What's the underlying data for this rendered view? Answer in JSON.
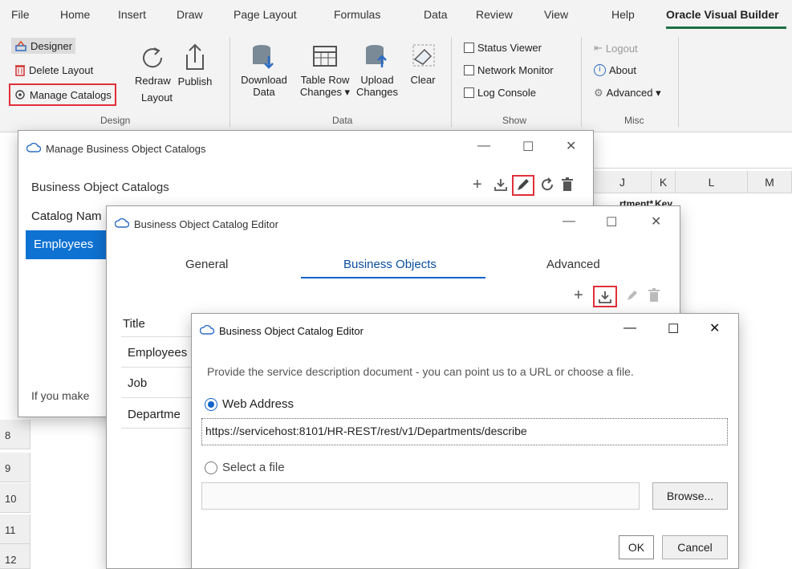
{
  "ribbon_tabs": [
    "File",
    "Home",
    "Insert",
    "Draw",
    "Page Layout",
    "Formulas",
    "Data",
    "Review",
    "View",
    "Help",
    "Oracle Visual Builder"
  ],
  "design_group": {
    "designer": "Designer",
    "delete_layout": "Delete Layout",
    "manage_catalogs": "Manage Catalogs",
    "redraw_line1": "Redraw",
    "redraw_line2": "Layout",
    "publish": "Publish",
    "label": "Design"
  },
  "data_group": {
    "download_line1": "Download",
    "download_line2": "Data",
    "tablerow_line1": "Table Row",
    "tablerow_line2": "Changes ▾",
    "upload_line1": "Upload",
    "upload_line2": "Changes",
    "clear": "Clear",
    "label": "Data"
  },
  "show_group": {
    "status_viewer": "Status Viewer",
    "network_monitor": "Network Monitor",
    "log_console": "Log Console",
    "label": "Show"
  },
  "misc_group": {
    "logout": "Logout",
    "about": "About",
    "advanced": "Advanced ▾",
    "label": "Misc"
  },
  "sheet": {
    "columns": [
      "J",
      "K",
      "L",
      "M"
    ],
    "cell_j": "…rtment*",
    "cell_k": "Key",
    "rows": [
      "8",
      "9",
      "10",
      "11",
      "12"
    ]
  },
  "manage_dialog": {
    "title": "Manage Business Object Catalogs",
    "heading": "Business Object Catalogs",
    "col_header": "Catalog Nam",
    "row": "Employees",
    "footer": "If you make"
  },
  "editor_dialog": {
    "title": "Business Object Catalog Editor",
    "tabs": [
      "General",
      "Business Objects",
      "Advanced"
    ],
    "list_header": "Title",
    "rows": [
      "Employees",
      "Job",
      "Departme"
    ]
  },
  "url_dialog": {
    "title": "Business Object Catalog Editor",
    "prompt": "Provide the service description document - you can point us to a URL or choose a file.",
    "web_address_label": "Web Address",
    "url_value": "https://servicehost:8101/HR-REST/rest/v1/Departments/describe",
    "select_file_label": "Select a file",
    "file_value": "",
    "browse": "Browse...",
    "ok": "OK",
    "cancel": "Cancel"
  },
  "colors": {
    "accent_green": "#1e7145",
    "highlight_red": "#e0303a",
    "selection_blue": "#0e64c8"
  }
}
